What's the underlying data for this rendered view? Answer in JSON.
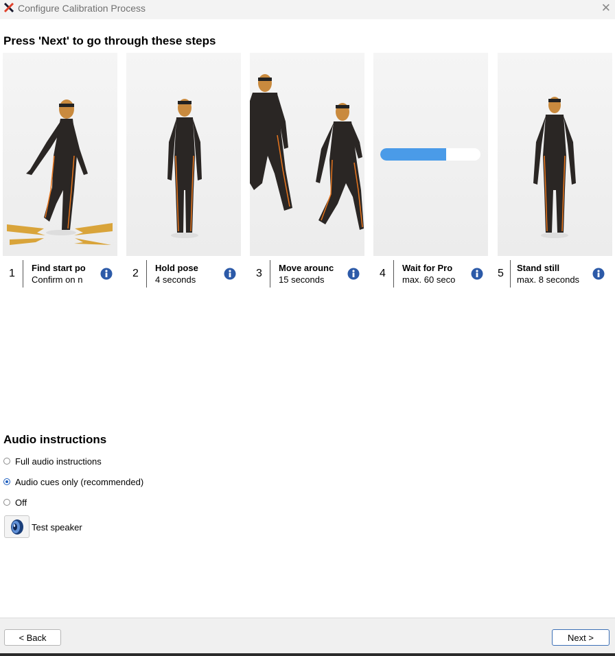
{
  "window": {
    "title": "Configure Calibration Process",
    "close_icon": "close-icon"
  },
  "heading": "Press 'Next' to go through these steps",
  "steps": [
    {
      "number": "1",
      "title": "Find start po",
      "subtitle": "Confirm on n"
    },
    {
      "number": "2",
      "title": "Hold pose",
      "subtitle": "4 seconds"
    },
    {
      "number": "3",
      "title": "Move arounc",
      "subtitle": "15 seconds"
    },
    {
      "number": "4",
      "title": "Wait for Pro",
      "subtitle": "max. 60 seco",
      "progress": 0.66
    },
    {
      "number": "5",
      "title": "Stand still",
      "subtitle": "max. 8 seconds"
    }
  ],
  "audio": {
    "heading": "Audio instructions",
    "options": [
      {
        "label": "Full audio instructions",
        "selected": false
      },
      {
        "label": "Audio cues only (recommended)",
        "selected": true
      },
      {
        "label": "Off",
        "selected": false
      }
    ],
    "test_speaker": "Test speaker"
  },
  "footer": {
    "back": "< Back",
    "next": "Next >"
  },
  "colors": {
    "accent": "#1f5fbf",
    "suit": "#2a2624",
    "stripe": "#e8761e",
    "skin": "#c98a3e",
    "progress": "#4a9be8",
    "arrow": "#d9a43a"
  }
}
